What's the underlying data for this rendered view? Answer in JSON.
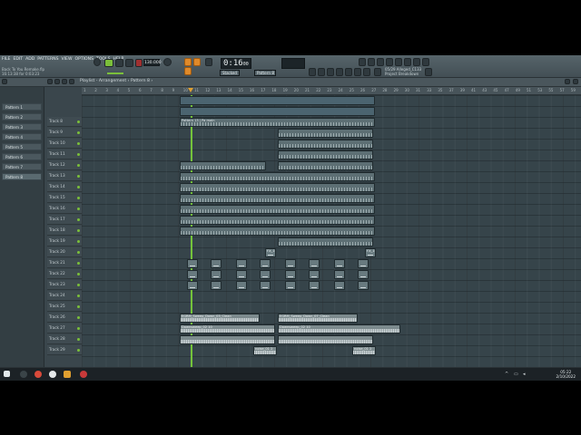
{
  "menu": [
    "FILE",
    "EDIT",
    "ADD",
    "PATTERNS",
    "VIEW",
    "OPTIONS",
    "TOOLS",
    "HELP"
  ],
  "song": {
    "title": "Back To You Remake.flp",
    "subtitle": "16:13:38 for 0:03:23"
  },
  "transport": {
    "time": "0:16",
    "time_small": "00",
    "tempo": "130.000",
    "pattern": "Pattern 8",
    "mode": "Stacked"
  },
  "hint": {
    "line1": "05/29  Alleged_C133",
    "line2": "Project Breakdown"
  },
  "playlist": {
    "title": "Playlist - Arrangement › Pattern 8 ›"
  },
  "ruler": [
    "1",
    "2",
    "3",
    "4",
    "5",
    "6",
    "7",
    "8",
    "9",
    "10",
    "11",
    "12",
    "13",
    "14",
    "15",
    "16",
    "17",
    "18",
    "19",
    "20",
    "21",
    "22",
    "23",
    "24",
    "25",
    "26",
    "27",
    "28",
    "29",
    "30",
    "31",
    "33",
    "35",
    "37",
    "39",
    "41",
    "43",
    "45",
    "47",
    "49",
    "51",
    "53",
    "55",
    "57",
    "59"
  ],
  "patterns": [
    "Pattern 1",
    "Pattern 2",
    "Pattern 3",
    "Pattern 4",
    "Pattern 5",
    "Pattern 6",
    "Pattern 7",
    "Pattern 8"
  ],
  "tracks": [
    "Track 8",
    "Track 9",
    "Track 10",
    "Track 11",
    "Track 12",
    "Track 13",
    "Track 14",
    "Track 15",
    "Track 16",
    "Track 17",
    "Track 18",
    "Track 19",
    "Track 20",
    "Track 21",
    "Track 22",
    "Track 23",
    "Track 24",
    "Track 25",
    "Track 26",
    "Track 27",
    "Track 28",
    "Track 29"
  ],
  "clips": {
    "melody": "Pattern 13 | Pa main",
    "sweep1": "EGRM_Sweep_Down_03_Clean",
    "sweep2": "EGRM_Sweep_Down_07_Clean",
    "rev1": "Downsweep_02 10",
    "rev2": "Downsweep_02 10",
    "fx": "FX_10",
    "noise": "noise_01 2"
  },
  "clock": {
    "time": "05:22",
    "date": "2/10/2022"
  }
}
